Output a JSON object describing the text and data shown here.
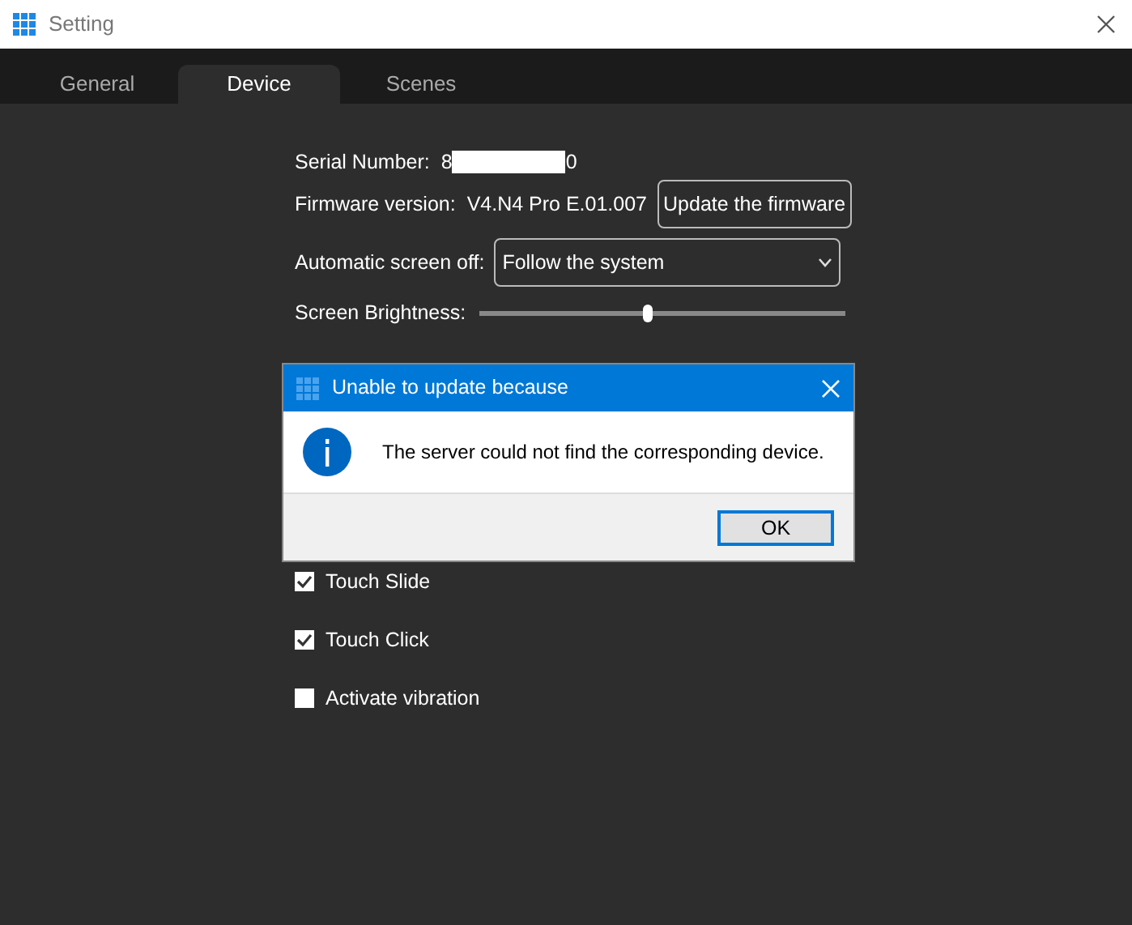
{
  "window": {
    "title": "Setting"
  },
  "tabs": [
    {
      "label": "General",
      "selected": false
    },
    {
      "label": "Device",
      "selected": true
    },
    {
      "label": "Scenes",
      "selected": false
    }
  ],
  "serial_number": {
    "label": "Serial Number:",
    "value_start": "8",
    "value_end": "0"
  },
  "firmware": {
    "label": "Firmware version:",
    "value": "V4.N4 Pro E.01.007",
    "button": "Update the firmware"
  },
  "screen_off": {
    "label": "Automatic screen off:",
    "value": "Follow the system"
  },
  "brightness": {
    "label": "Screen Brightness:",
    "level": 0.46
  },
  "options": [
    {
      "label": "Touch Slide",
      "checked": true
    },
    {
      "label": "Touch Click",
      "checked": true
    },
    {
      "label": "Activate vibration",
      "checked": false
    }
  ],
  "dialog": {
    "title": "Unable to update because",
    "message": "The server could not find the corresponding device.",
    "button": "OK"
  }
}
